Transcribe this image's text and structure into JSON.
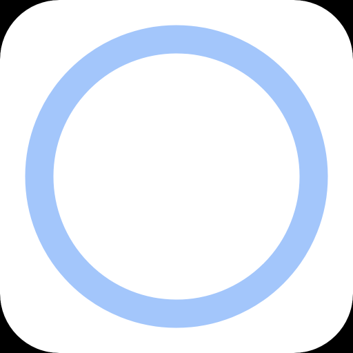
{
  "icon": {
    "name": "circle-ring-icon",
    "colors": {
      "background": "#000000",
      "tile": "#ffffff",
      "ring": "#a3c6fb"
    }
  }
}
